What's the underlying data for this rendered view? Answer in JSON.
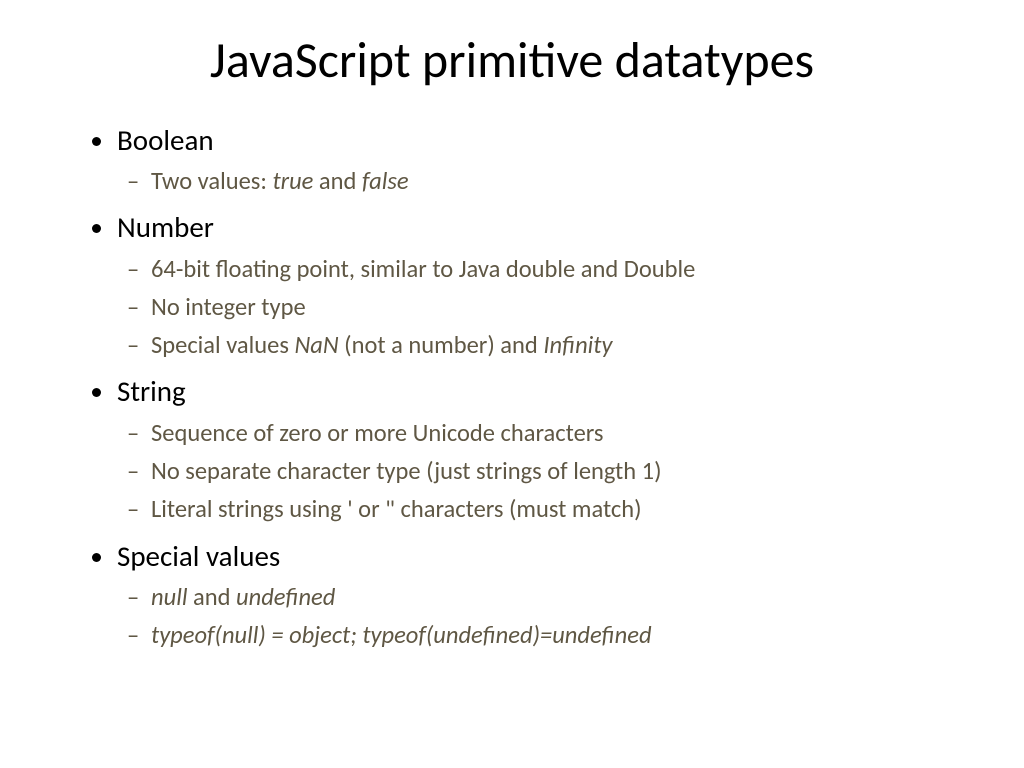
{
  "title": "JavaScript primitive datatypes",
  "items": [
    {
      "label": "Boolean",
      "sub": [
        {
          "prefix": "Two values: ",
          "italic1": "true",
          "mid": " and ",
          "italic2": "false"
        }
      ]
    },
    {
      "label": "Number",
      "sub": [
        {
          "text": "64-bit floating point, similar to Java double and Double"
        },
        {
          "text": "No integer type"
        },
        {
          "prefix": "Special values ",
          "italic1": "NaN",
          "mid": "  (not a number) and ",
          "italic2": "Infinity"
        }
      ]
    },
    {
      "label": "String",
      "sub": [
        {
          "text": "Sequence of zero or more Unicode characters"
        },
        {
          "text": "No separate character type (just strings of length 1)"
        },
        {
          "text": "Literal strings using ' or \" characters  (must match)"
        }
      ]
    },
    {
      "label": "Special values",
      "sub": [
        {
          "italic1": "null",
          "mid": "  and ",
          "italic2": "undefined"
        },
        {
          "italicfull": "typeof(null) = object;      typeof(undefined)=undefined"
        }
      ]
    }
  ]
}
